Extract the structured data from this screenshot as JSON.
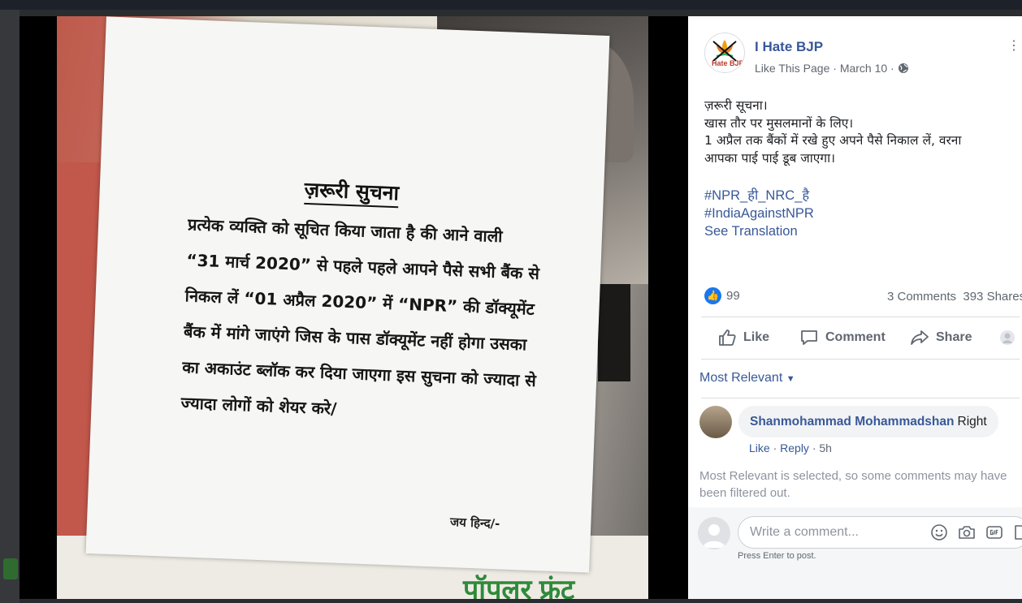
{
  "poster": {
    "title": "ज़रूरी सुचना",
    "lines": [
      "प्रत्येक व्यक्ति को सूचित किया जाता है की आने वाली",
      "“31 मार्च 2020” से पहले पहले आपने पैसे सभी बैंक से",
      "निकल लें “01 अप्रैल 2020” में “NPR” की डॉक्यूमेंट",
      "बैंक में मांगे जाएंगे जिस के पास डॉक्यूमेंट नहीं होगा उसका",
      "का अकाउंट ब्लॉक कर दिया जाएगा इस सुचना को ज्यादा से",
      "ज्यादा लोगों को शेयर करे/"
    ],
    "signature": "जय हिन्द/-",
    "bottom_text": "पॉपलर फ्रंट"
  },
  "post": {
    "page_name": "I Hate BJP",
    "avatar_text": "Hate BJP",
    "like_page": "Like This Page",
    "separator": " · ",
    "date": "March 10",
    "audience_icon": "globe-icon",
    "text_lines": [
      "ज़रूरी सूचना।",
      "खास तौर पर मुसलमानों के लिए।",
      "1 अप्रैल तक बैंकों में रखे हुए अपने पैसे निकाल लें, वरना",
      "आपका पाई पाई डूब जाएगा।"
    ],
    "hashtags": [
      "#NPR_ही_NRC_है",
      "#IndiaAgainstNPR"
    ],
    "see_translation": "See Translation"
  },
  "stats": {
    "reactions": "99",
    "comments": "3 Comments",
    "shares": "393 Shares"
  },
  "actions": {
    "like": "Like",
    "comment": "Comment",
    "share": "Share"
  },
  "comments_section": {
    "sort_label": "Most Relevant",
    "comment": {
      "author": "Shanmohammad Mohammadshan",
      "text": "Right",
      "like": "Like",
      "reply": "Reply",
      "time": "5h"
    },
    "filter_note": "Most Relevant is selected, so some comments may have been filtered out.",
    "composer_placeholder": "Write a comment...",
    "press_enter": "Press Enter to post."
  },
  "colors": {
    "link_blue": "#385898",
    "like_blue": "#1877f2",
    "secondary_text": "#606770"
  }
}
